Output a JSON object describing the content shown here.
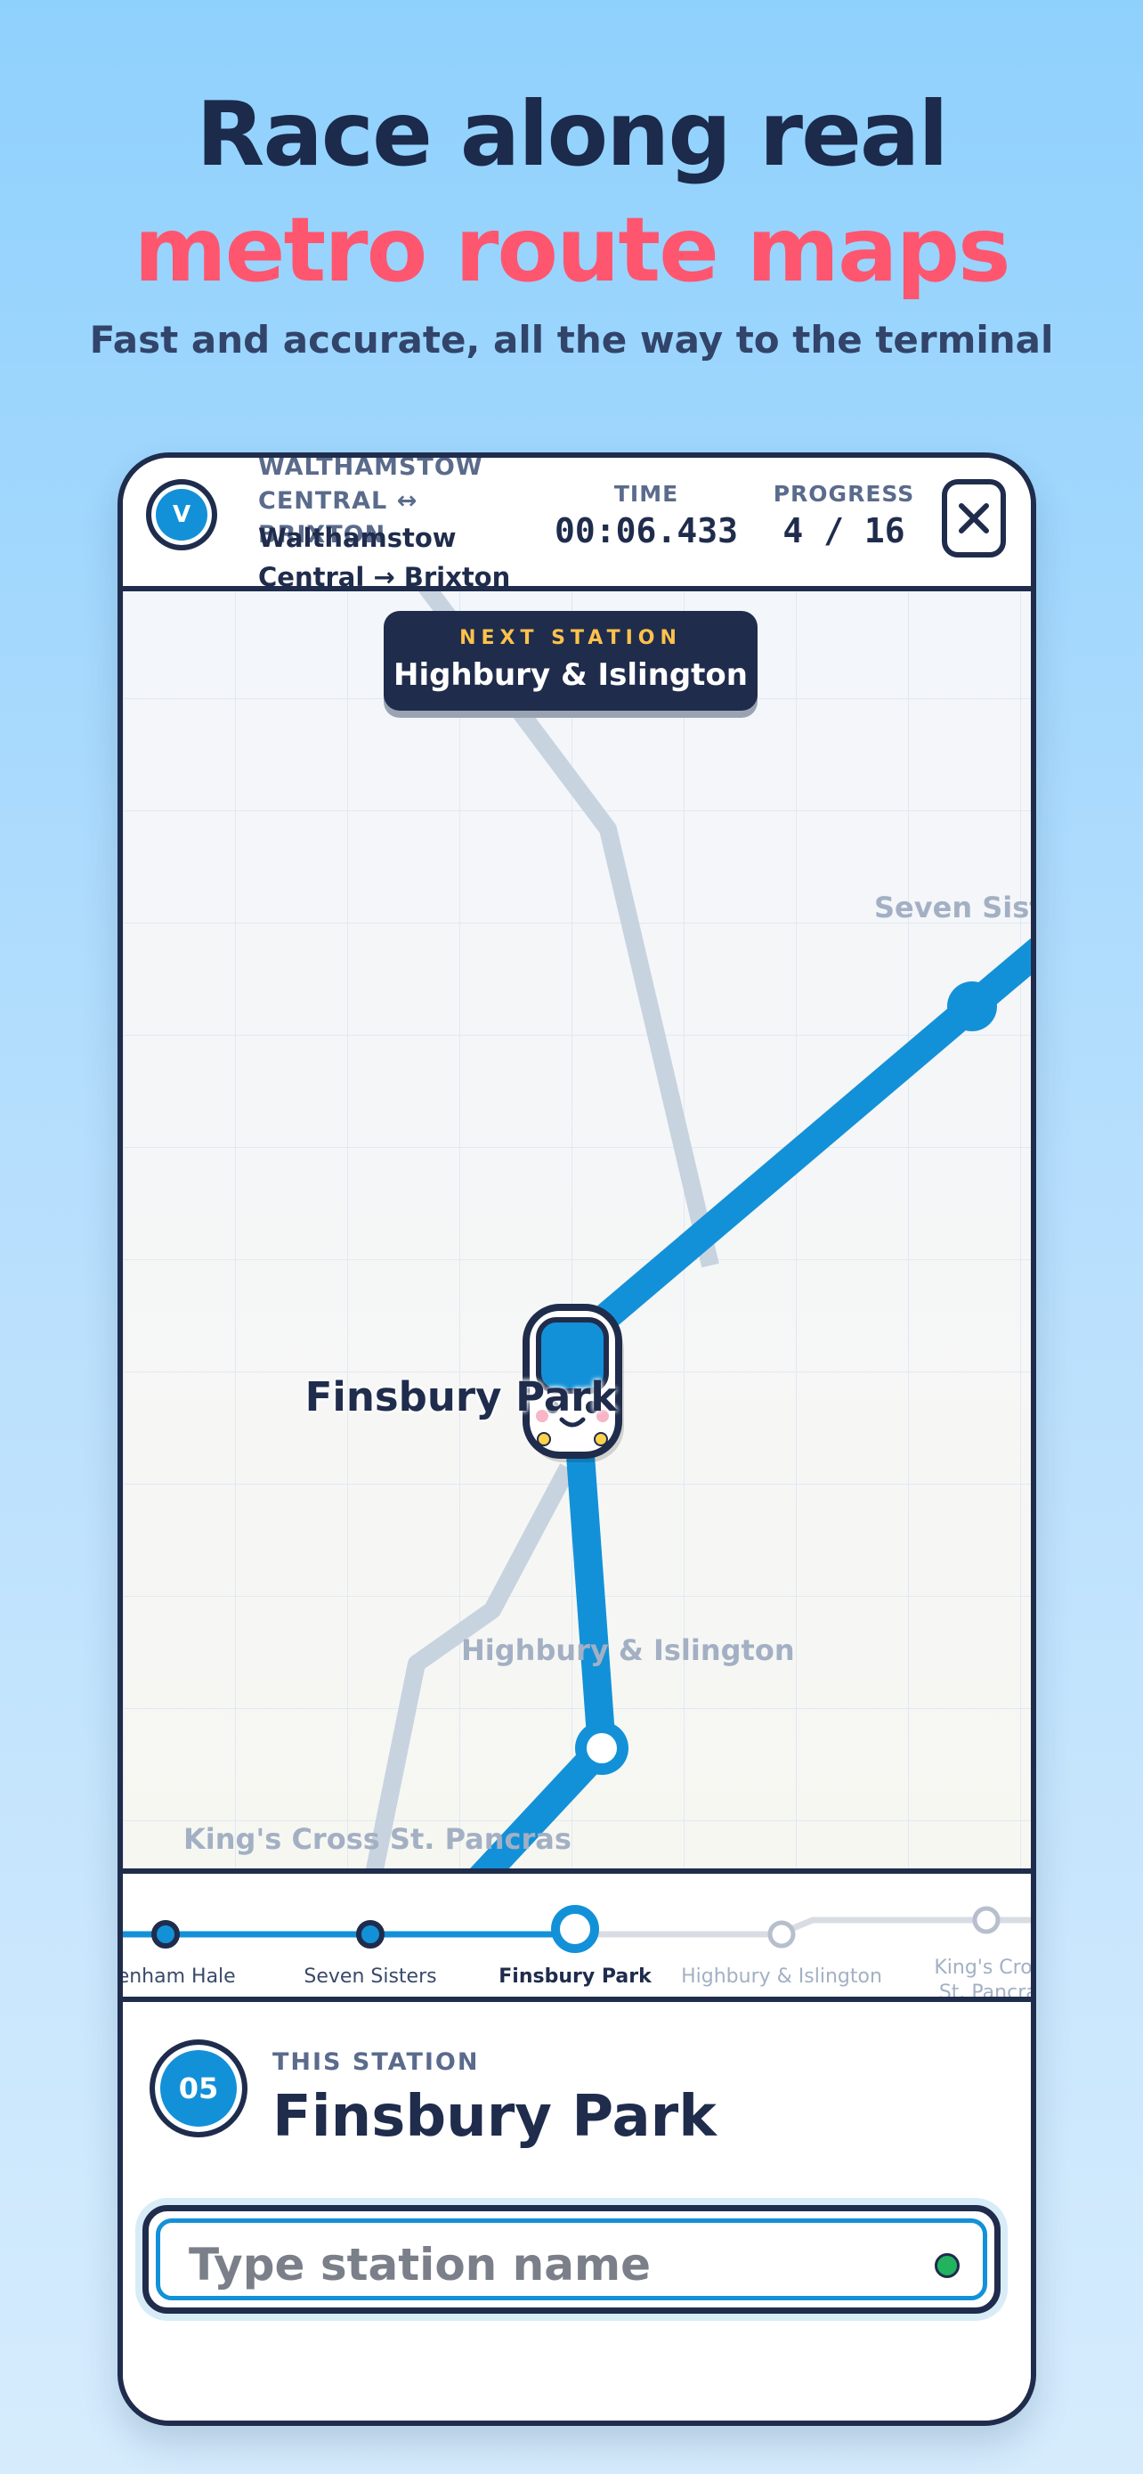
{
  "promo": {
    "headline_1": "Race along real",
    "headline_2": "metro route maps",
    "subtitle": "Fast and accurate, all the way to the terminal"
  },
  "header": {
    "line_badge": "V",
    "route_name": "WALTHAMSTOW CENTRAL ↔ BRIXTON",
    "route_direction": "Walthamstow Central → Brixton",
    "time_label": "TIME",
    "time_value": "00:06.433",
    "progress_label": "PROGRESS",
    "progress_value": "4 / 16",
    "close_icon": "close-icon"
  },
  "next_station": {
    "label": "NEXT STATION",
    "name": "Highbury & Islington"
  },
  "map": {
    "current_station": "Finsbury Park",
    "labels": {
      "seven_sisters": "Seven Sisters",
      "highbury": "Highbury & Islington",
      "kings_cross": "King's Cross St. Pancras"
    },
    "line_color": "#1391d8",
    "other_line_color": "#c8d3e0"
  },
  "strip": {
    "stations": [
      {
        "name": "Tottenham Hale",
        "state": "passed"
      },
      {
        "name": "Seven Sisters",
        "state": "passed"
      },
      {
        "name": "Finsbury Park",
        "state": "current"
      },
      {
        "name": "Highbury & Islington",
        "state": "upcoming"
      },
      {
        "name": "King's Cross St. Pancras",
        "state": "upcoming"
      }
    ]
  },
  "panel": {
    "station_number": "05",
    "this_label": "THIS STATION",
    "this_name": "Finsbury Park",
    "input_placeholder": "Type station name",
    "input_value": ""
  }
}
